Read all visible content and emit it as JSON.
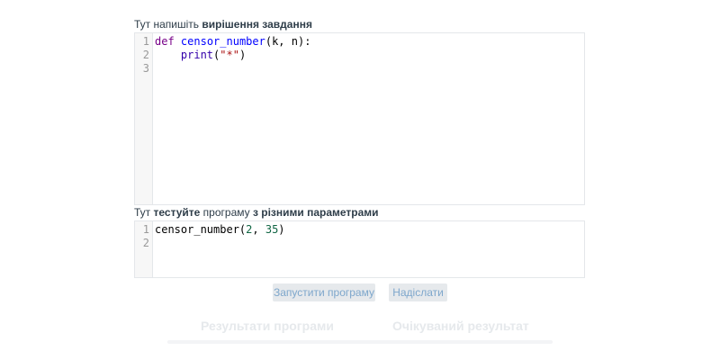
{
  "solution_label": {
    "prefix": "Тут напишіть ",
    "bold": "вирішення завдання"
  },
  "solution_editor": {
    "lines": [
      {
        "num": "1"
      },
      {
        "num": "2"
      },
      {
        "num": "3"
      }
    ],
    "code": {
      "l1_kw": "def",
      "l1_fn": "censor_number",
      "l1_rest": "(k, n):",
      "l2_indent": "    ",
      "l2_fn": "print",
      "l2_open": "(",
      "l2_str": "\"*\"",
      "l2_close": ")"
    }
  },
  "test_label": {
    "prefix": "Тут ",
    "bold1": "тестуйте",
    "mid": " програму ",
    "bold2": "з різними параметрами"
  },
  "test_editor": {
    "lines": [
      {
        "num": "1"
      },
      {
        "num": "2"
      }
    ],
    "code": {
      "l1_fn": "censor_number(",
      "l1_n1": "2",
      "l1_sep": ", ",
      "l1_n2": "35",
      "l1_close": ")"
    }
  },
  "buttons": {
    "run": "Запустити програму",
    "send": "Надіслати"
  },
  "results": {
    "program": "Результати програми",
    "expected": "Очікуваний результат"
  }
}
